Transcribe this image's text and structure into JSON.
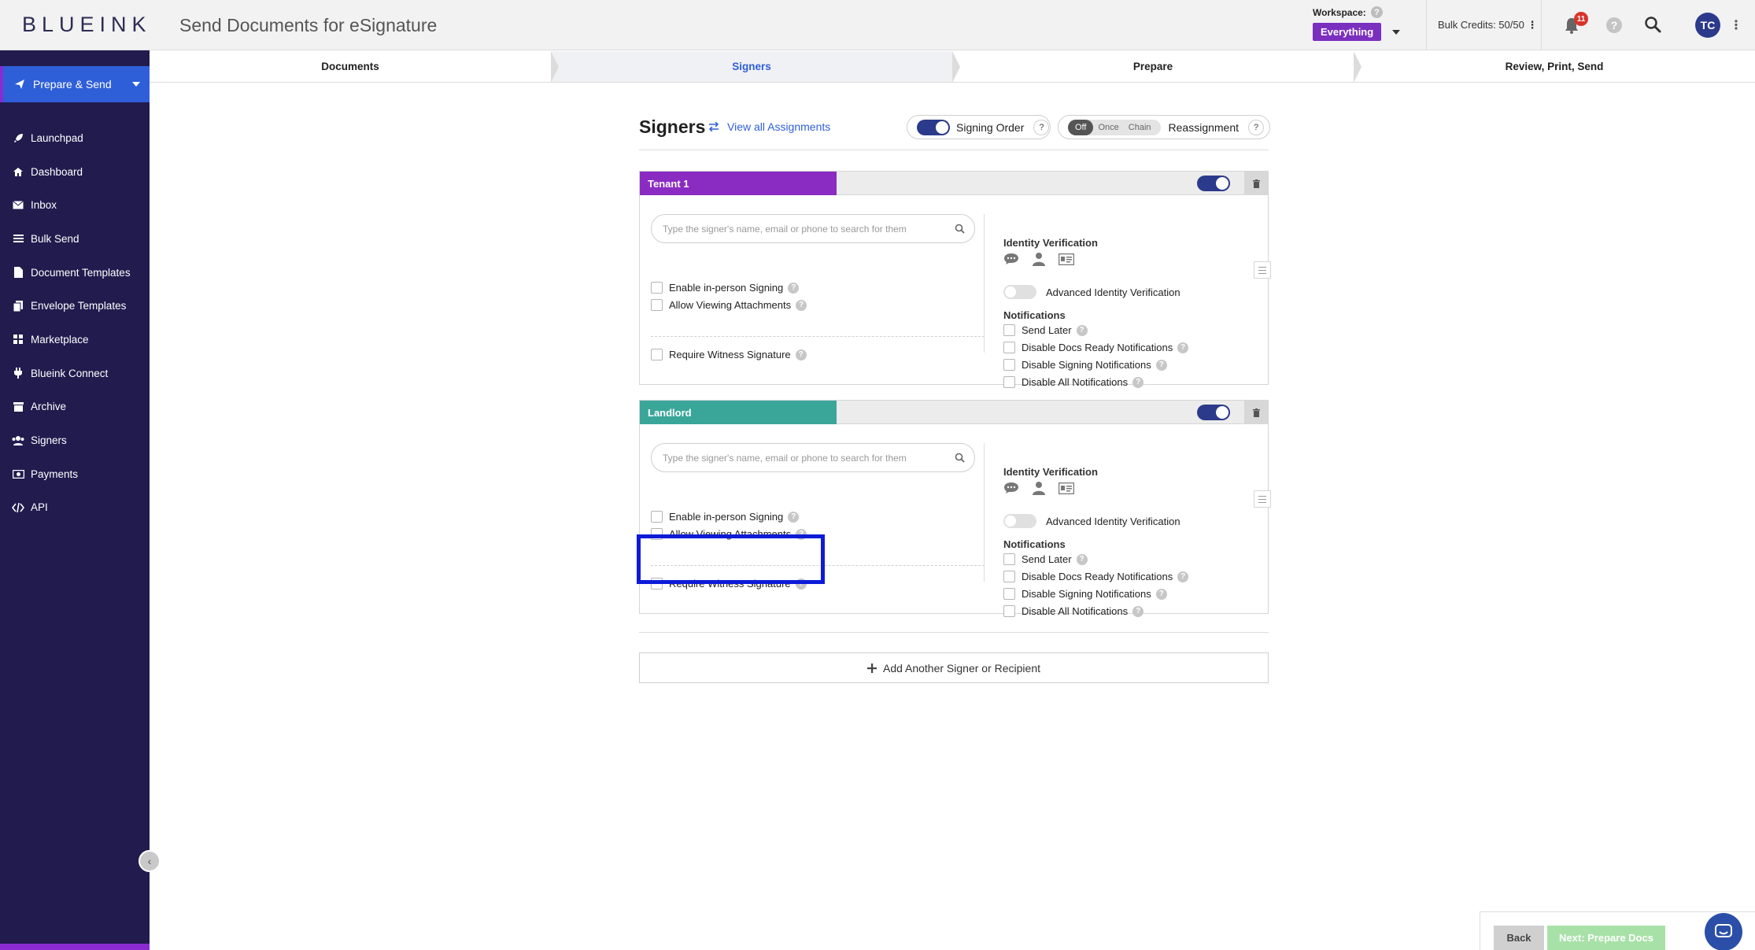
{
  "header": {
    "logo": "BLUEINK",
    "title": "Send Documents for eSignature",
    "workspace_label": "Workspace:",
    "workspace_value": "Everything",
    "bulk_credits": "Bulk Credits: 50/50",
    "notification_count": "11",
    "avatar_initials": "TC",
    "help_glyph": "?"
  },
  "sidebar": {
    "primary": "Prepare & Send",
    "items": [
      {
        "label": "Launchpad",
        "icon": "rocket-icon"
      },
      {
        "label": "Dashboard",
        "icon": "home-icon"
      },
      {
        "label": "Inbox",
        "icon": "envelope-icon"
      },
      {
        "label": "Bulk Send",
        "icon": "list-icon"
      },
      {
        "label": "Document Templates",
        "icon": "file-icon"
      },
      {
        "label": "Envelope Templates",
        "icon": "copy-icon"
      },
      {
        "label": "Marketplace",
        "icon": "grid-icon"
      },
      {
        "label": "Blueink Connect",
        "icon": "plug-icon"
      },
      {
        "label": "Archive",
        "icon": "archive-icon"
      },
      {
        "label": "Signers",
        "icon": "users-icon"
      },
      {
        "label": "Payments",
        "icon": "money-icon"
      },
      {
        "label": "API",
        "icon": "code-icon"
      }
    ]
  },
  "steps": [
    "Documents",
    "Signers",
    "Prepare",
    "Review, Print, Send"
  ],
  "signers_section": {
    "title": "Signers",
    "view_all": "View all Assignments",
    "signing_order": "Signing Order",
    "reassign_options": [
      "Off",
      "Once",
      "Chain"
    ],
    "reassignment": "Reassignment",
    "help": "?"
  },
  "signer_cards": [
    {
      "role": "Tenant 1",
      "role_color": "#8a2bc2",
      "search_placeholder": "Type the signer's name, email or phone to search for them",
      "enable_in_person": "Enable in-person Signing",
      "allow_attachments": "Allow Viewing Attachments",
      "require_witness": "Require Witness Signature",
      "identity_verification": "Identity Verification",
      "advanced_idv": "Advanced Identity Verification",
      "notifications": "Notifications",
      "send_later": "Send Later",
      "disable_docs_ready": "Disable Docs Ready Notifications",
      "disable_signing": "Disable Signing Notifications",
      "disable_all": "Disable All Notifications"
    },
    {
      "role": "Landlord",
      "role_color": "#3aa69a",
      "search_placeholder": "Type the signer's name, email or phone to search for them",
      "enable_in_person": "Enable in-person Signing",
      "allow_attachments": "Allow Viewing Attachments",
      "require_witness": "Require Witness Signature",
      "identity_verification": "Identity Verification",
      "advanced_idv": "Advanced Identity Verification",
      "notifications": "Notifications",
      "send_later": "Send Later",
      "disable_docs_ready": "Disable Docs Ready Notifications",
      "disable_signing": "Disable Signing Notifications",
      "disable_all": "Disable All Notifications"
    }
  ],
  "add_signer": "Add Another Signer or Recipient",
  "footer": {
    "back": "Back",
    "next": "Next: Prepare Docs"
  },
  "colors": {
    "accent": "#2f5fd8",
    "sidebar": "#211b4e",
    "highlight": "#0d1bd8"
  }
}
